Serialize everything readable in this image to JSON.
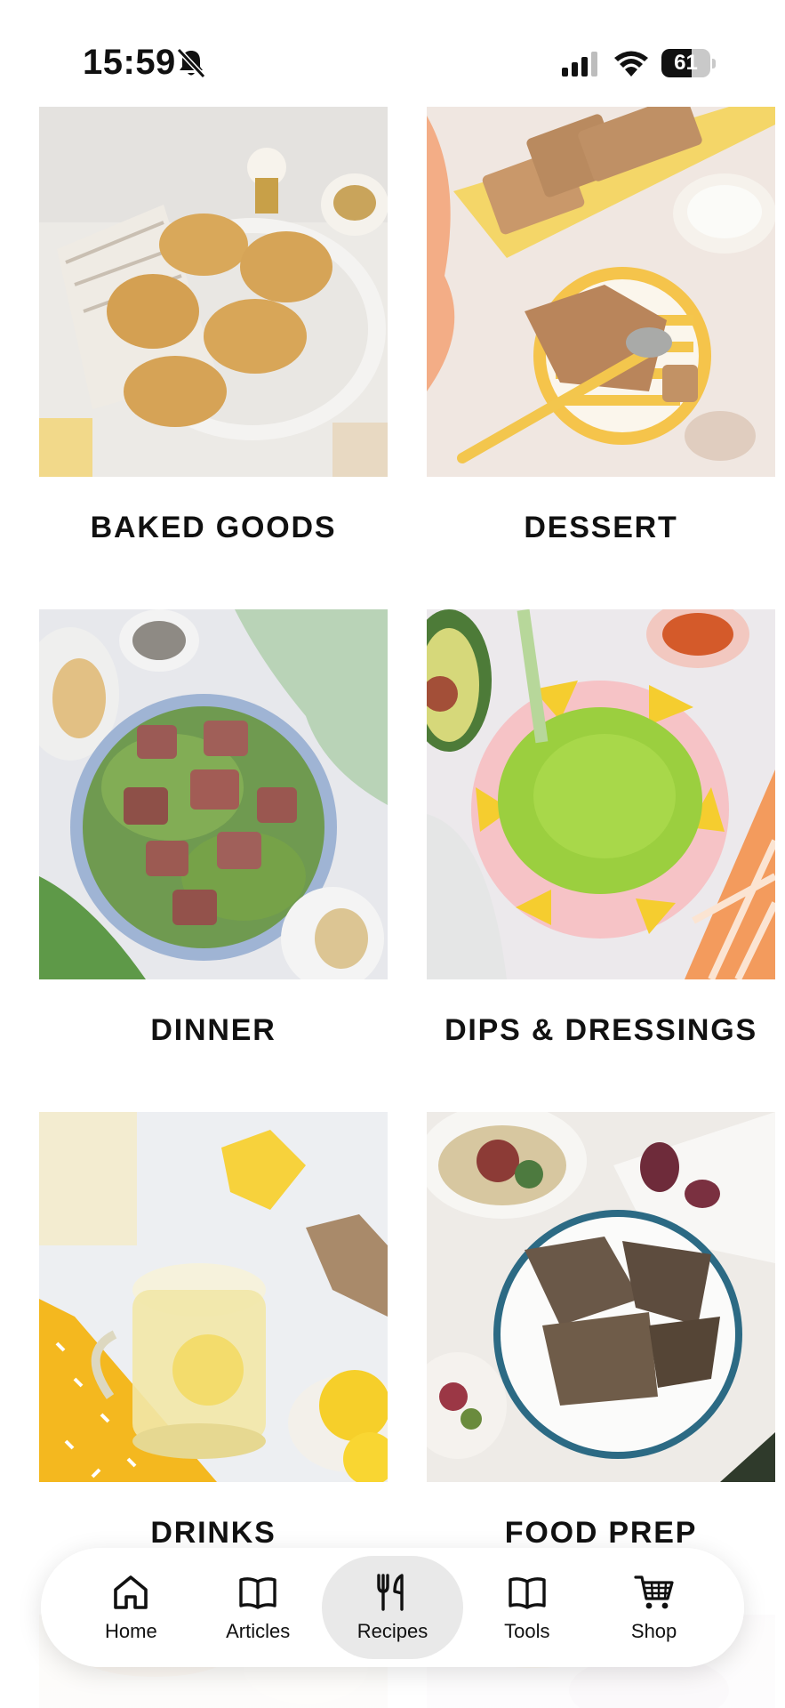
{
  "status_bar": {
    "time": "15:59",
    "battery_level": "61",
    "battery_fraction": 0.61,
    "icons": [
      "bell-slash-icon",
      "cellular-signal-icon",
      "wifi-icon",
      "battery-icon"
    ]
  },
  "categories": [
    {
      "label": "BAKED GOODS"
    },
    {
      "label": "DESSERT"
    },
    {
      "label": "DINNER"
    },
    {
      "label": "DIPS & DRESSINGS"
    },
    {
      "label": "DRINKS"
    },
    {
      "label": "FOOD PREP"
    }
  ],
  "bottom_nav": {
    "items": [
      {
        "label": "Home",
        "icon": "home-icon"
      },
      {
        "label": "Articles",
        "icon": "book-open-icon"
      },
      {
        "label": "Recipes",
        "icon": "fork-knife-icon"
      },
      {
        "label": "Tools",
        "icon": "book-open-icon"
      },
      {
        "label": "Shop",
        "icon": "shopping-cart-icon"
      }
    ],
    "active": "Recipes",
    "active_bg": "#e9e9e9"
  }
}
